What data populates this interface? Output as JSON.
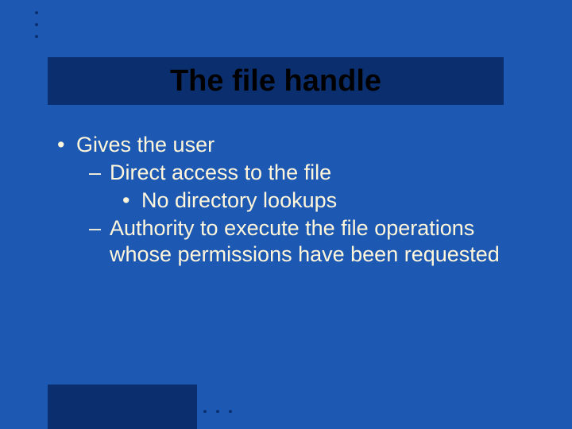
{
  "slide": {
    "title": "The file handle",
    "bullets": {
      "b1": "Gives the user",
      "b1a": "Direct access to the file",
      "b1a_i": "No directory lookups",
      "b1b": "Authority to execute the file operations whose permissions have been requested"
    }
  }
}
